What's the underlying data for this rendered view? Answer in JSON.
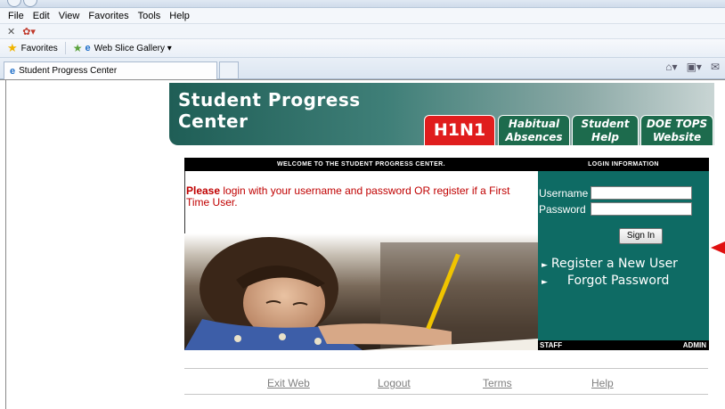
{
  "browser": {
    "menu": [
      "File",
      "Edit",
      "View",
      "Favorites",
      "Tools",
      "Help"
    ],
    "favorites_label": "Favorites",
    "web_slice_label": "Web Slice Gallery ▾",
    "tab_title": "Student Progress Center"
  },
  "banner": {
    "title_line1": "Student Progress",
    "title_line2": "Center",
    "tabs": [
      {
        "line1": "H1N1",
        "line2": ""
      },
      {
        "line1": "Habitual",
        "line2": "Absences"
      },
      {
        "line1": "Student",
        "line2": "Help"
      },
      {
        "line1": "DOE TOPS",
        "line2": "Website"
      }
    ]
  },
  "main": {
    "welcome_header": "WELCOME TO THE STUDENT PROGRESS CENTER.",
    "intro_bold": "Please",
    "intro_text": " login with your username and password OR register if a First Time User."
  },
  "login": {
    "header": "LOGIN INFORMATION",
    "username_label": "Username",
    "password_label": "Password",
    "sign_in_label": "Sign In",
    "register_link": "Register a New User",
    "forgot_link": "Forgot Password",
    "staff_label": "STAFF",
    "admin_label": "ADMIN"
  },
  "footer": {
    "links": [
      "Exit Web",
      "Logout",
      "Terms",
      "Help"
    ]
  },
  "colors": {
    "login_panel": "#0e6b64",
    "h1n1_tab": "#e01d1d",
    "intro_text": "#c00000"
  }
}
